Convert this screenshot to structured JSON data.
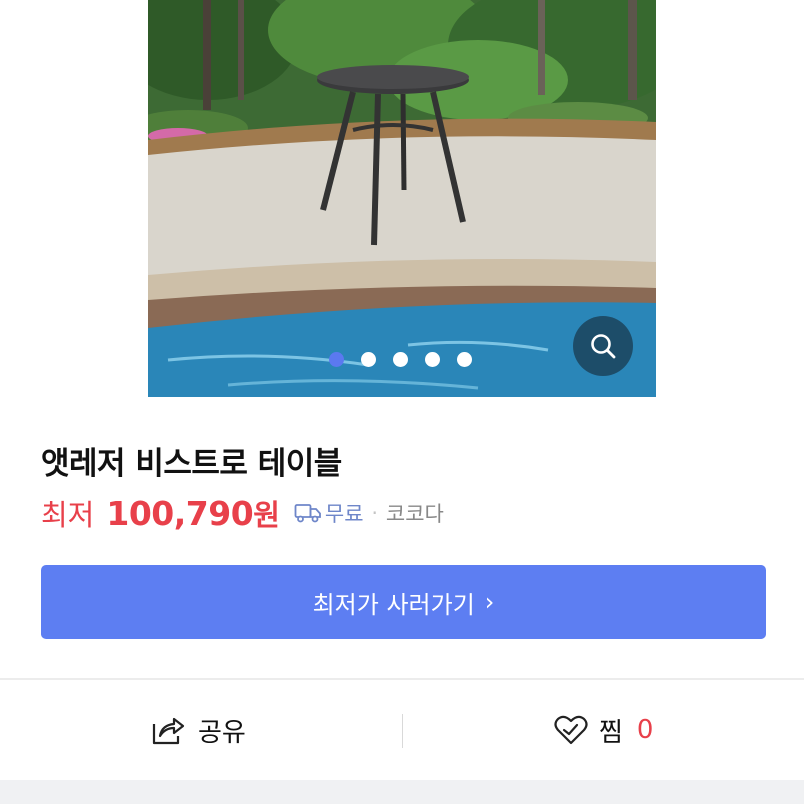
{
  "product": {
    "title": "앳레저 비스트로 테이블",
    "price_label": "최저",
    "price": "100,790",
    "price_unit": "원",
    "shipping": "무료",
    "separator": "·",
    "seller": "코코다"
  },
  "gallery": {
    "image_count": 5,
    "active_index": 0
  },
  "buy_button": {
    "label": "최저가 사러가기",
    "arrow": "›"
  },
  "actions": {
    "share_label": "공유",
    "like_label": "찜",
    "like_count": "0"
  },
  "colors": {
    "accent": "#5d7ef2",
    "price": "#e8404a",
    "shipping": "#6e86c9"
  },
  "icons": [
    "search-icon",
    "truck-icon",
    "share-icon",
    "heart-icon"
  ]
}
